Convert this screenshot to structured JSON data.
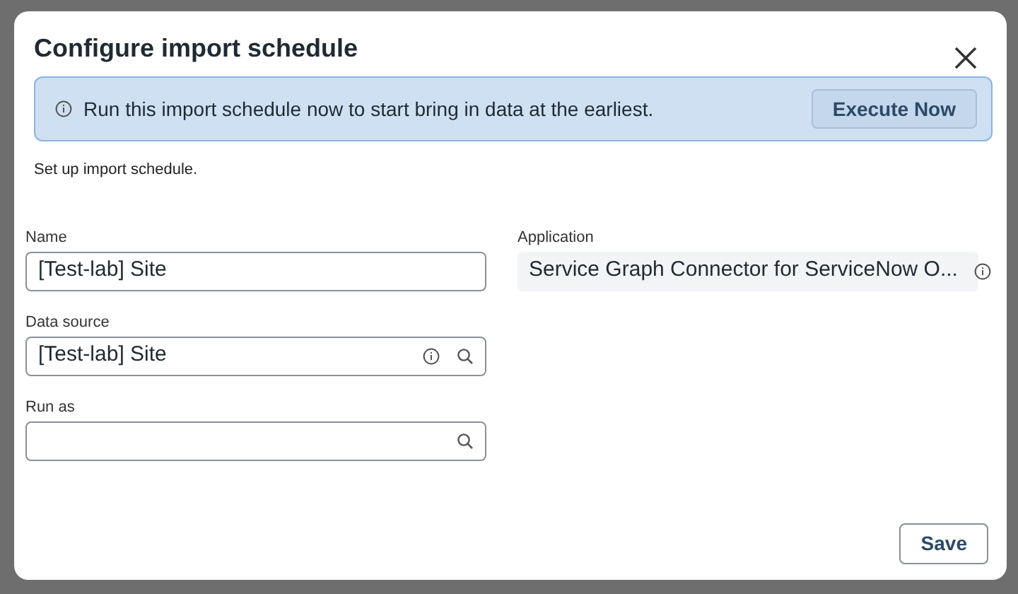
{
  "dialog": {
    "title": "Configure import schedule",
    "banner": {
      "message": "Run this import schedule now to start bring in data at the earliest.",
      "button": "Execute Now"
    },
    "intro": "Set up import schedule.",
    "left_fields": [
      {
        "label": "Name",
        "value": "[Test-lab] Site",
        "kind": "text"
      },
      {
        "label": "Data source",
        "value": "[Test-lab] Site",
        "kind": "reference"
      },
      {
        "label": "Run as",
        "kind": "lookup"
      }
    ],
    "right_fields": [
      {
        "label": "Application",
        "value": "Service Graph Connector for ServiceNow O...",
        "kind": "readonly"
      }
    ],
    "buttons": [
      "Save"
    ]
  }
}
